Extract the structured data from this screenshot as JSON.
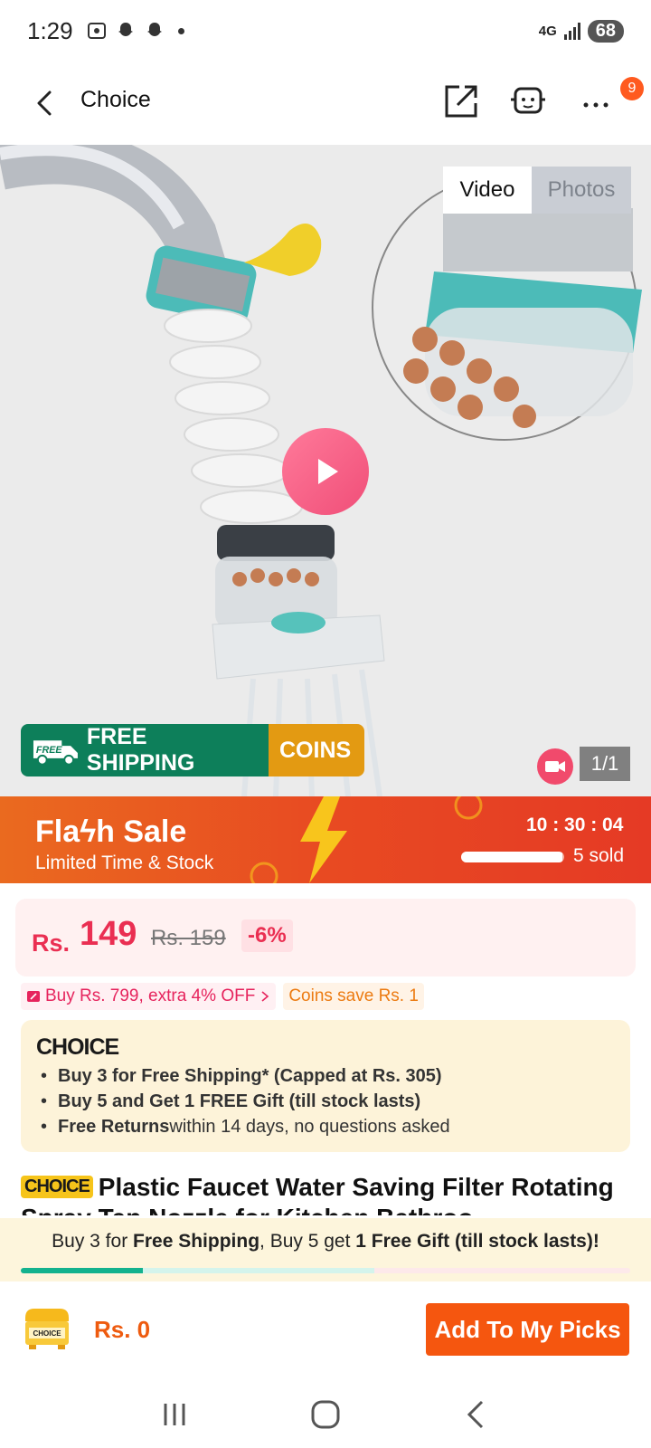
{
  "status_bar": {
    "time": "1:29",
    "network": "4G",
    "battery": "68"
  },
  "header": {
    "title": "Choice",
    "notification_count": "9"
  },
  "gallery": {
    "tabs": [
      "Video",
      "Photos"
    ],
    "active_tab": "Video",
    "counter": "1/1",
    "shipping_banner": {
      "free_tag": "FREE",
      "label": "FREE SHIPPING",
      "coins": "COINS"
    }
  },
  "flash_sale": {
    "title": "Flaϟh Sale",
    "subtitle": "Limited Time & Stock",
    "countdown": "10 : 30 : 04",
    "sold": "5 sold",
    "progress": 0.98
  },
  "price": {
    "currency": "Rs.",
    "current": "149",
    "original": "Rs. 159",
    "discount": "-6%"
  },
  "promotions": [
    {
      "text": "Buy Rs. 799, extra 4% OFF",
      "color": "#e6245d"
    },
    {
      "text": "Coins save Rs. 1",
      "color": "#ec7b12"
    }
  ],
  "choice_box": {
    "logo": "CHOICE",
    "benefits": [
      {
        "bold": "Buy 3 for  Free Shipping* (Capped at Rs. 305)",
        "rest": ""
      },
      {
        "bold": "Buy 5 and Get 1 FREE Gift (till stock lasts)",
        "rest": ""
      },
      {
        "bold": "Free Returns",
        "rest": " within 14 days, no questions asked"
      }
    ]
  },
  "product": {
    "tag": "CHOICE",
    "title": "Plastic Faucet Water Saving Filter Rotating Spray Tap Nozzle for Kitchen Bathroo"
  },
  "bottom_promo": {
    "part1": "Buy 3 for ",
    "part2": "Free Shipping",
    "part3": ", Buy 5 get ",
    "part4": "1 Free Gift (till stock lasts)!",
    "progress": 0.2
  },
  "action_bar": {
    "chest_label": "CHOICE",
    "total": "Rs. 0",
    "add_button": "Add To My Picks"
  },
  "colors": {
    "accent": "#f5560f",
    "price": "#ea2f52",
    "shipping_green": "#0d7f5a",
    "coins_orange": "#e39a12"
  }
}
